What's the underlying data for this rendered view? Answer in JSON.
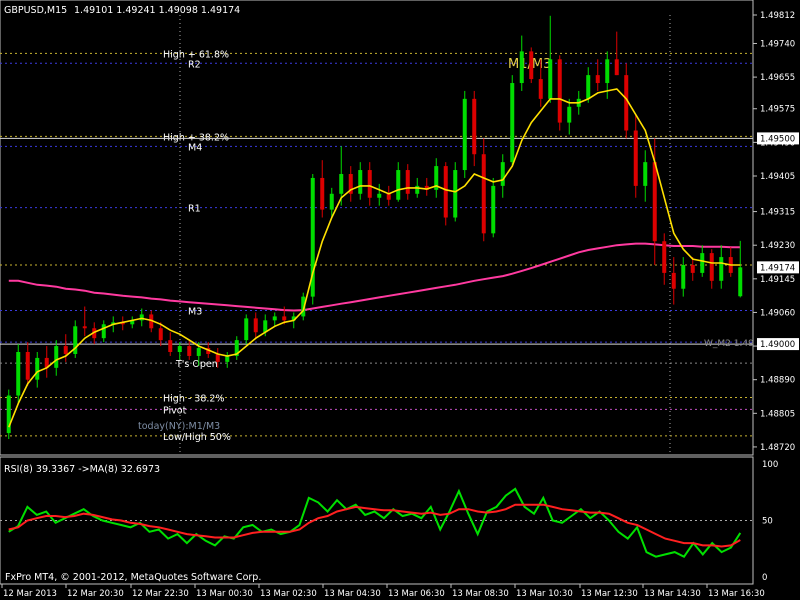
{
  "header": {
    "symbol": "GBPUSD,M15",
    "ohlc": "1.49101 1.49241 1.49098 1.49174"
  },
  "footer": {
    "copyright": "FxPro MT4, © 2001-2012, MetaQuotes Software Corp."
  },
  "colors": {
    "background": "#000000",
    "bull": "#00dd00",
    "bear": "#dd0000",
    "sma": "#ffe000",
    "ma_long": "#ff3aa0",
    "rsi": "#00e000",
    "rsi_ma": "#ff2020"
  },
  "chart_data": [
    {
      "type": "candlestick",
      "title": "GBPUSD,M15",
      "ylim": [
        1.48735,
        1.49812
      ],
      "y_ticks": [
        "1.49812",
        "1.49740",
        "1.49655",
        "1.49575",
        "1.49490",
        "1.49405",
        "1.49315",
        "1.49230",
        "1.49145",
        "1.49060",
        "1.48975",
        "1.48890",
        "1.48805",
        "1.48720"
      ],
      "current_price_label": "1.49174",
      "current_price": 1.49174,
      "line_price_label": "1.49500",
      "line_price": 1.495,
      "lower_price_label": "1.49000",
      "lower_price": 1.4898,
      "x_ticks": [
        "12 Mar 2013",
        "12 Mar 20:30",
        "12 Mar 22:30",
        "13 Mar 00:30",
        "13 Mar 02:30",
        "13 Mar 04:30",
        "13 Mar 06:30",
        "13 Mar 08:30",
        "13 Mar 10:30",
        "13 Mar 12:30",
        "13 Mar 14:30",
        "13 Mar 16:30"
      ],
      "levels": [
        {
          "label": "High + 61.8%",
          "price": 1.49715,
          "color": "#c8b430"
        },
        {
          "label": "R2",
          "price": 1.4969,
          "color": "#3a3ae0"
        },
        {
          "label": "High + 38.2%",
          "price": 1.49505,
          "color": "#c8b430"
        },
        {
          "label": "M4",
          "price": 1.4948,
          "color": "#3a3ae0"
        },
        {
          "label": "R1",
          "price": 1.49325,
          "color": "#3a3ae0"
        },
        {
          "label": "",
          "price": 1.4918,
          "color": "#c8b430"
        },
        {
          "label": "M3",
          "price": 1.49065,
          "color": "#3a3ae0"
        },
        {
          "label": "",
          "price": 1.48985,
          "color": "#3a3ae0"
        },
        {
          "label": "T's Open",
          "price": 1.48932,
          "color": "#888888"
        },
        {
          "label": "High - 38.2%",
          "price": 1.48845,
          "color": "#c8b430"
        },
        {
          "label": "Pivot",
          "price": 1.48815,
          "color": "#c050c0"
        },
        {
          "label": "Low/High 50%",
          "price": 1.48748,
          "color": "#c8b430"
        }
      ],
      "annotations": [
        "M1/M3",
        "today(NY):M1/M3",
        "W_M2 1.49"
      ],
      "candles": [
        [
          1.48755,
          1.48865,
          1.4874,
          1.4885
        ],
        [
          1.4885,
          1.4898,
          1.4883,
          1.4896
        ],
        [
          1.4896,
          1.48985,
          1.48875,
          1.4889
        ],
        [
          1.4889,
          1.4896,
          1.4887,
          1.48945
        ],
        [
          1.48945,
          1.48975,
          1.48895,
          1.4892
        ],
        [
          1.4892,
          1.4899,
          1.489,
          1.48975
        ],
        [
          1.48975,
          1.49005,
          1.48935,
          1.48955
        ],
        [
          1.48955,
          1.4904,
          1.48945,
          1.49025
        ],
        [
          1.49025,
          1.49075,
          1.49,
          1.4902
        ],
        [
          1.4902,
          1.49035,
          1.4898,
          1.48995
        ],
        [
          1.48995,
          1.4904,
          1.48985,
          1.4903
        ],
        [
          1.4903,
          1.4905,
          1.4901,
          1.49035
        ],
        [
          1.49035,
          1.4905,
          1.49015,
          1.4903
        ],
        [
          1.4903,
          1.4905,
          1.4902,
          1.4904
        ],
        [
          1.4904,
          1.4907,
          1.49025,
          1.49055
        ],
        [
          1.49055,
          1.49065,
          1.4901,
          1.4902
        ],
        [
          1.4902,
          1.49035,
          1.48975,
          1.4899
        ],
        [
          1.4899,
          1.4901,
          1.4895,
          1.4896
        ],
        [
          1.4896,
          1.48985,
          1.4894,
          1.48975
        ],
        [
          1.48975,
          1.4899,
          1.4894,
          1.4895
        ],
        [
          1.4895,
          1.48985,
          1.48925,
          1.4897
        ],
        [
          1.4897,
          1.48985,
          1.48945,
          1.48955
        ],
        [
          1.48955,
          1.4897,
          1.4892,
          1.48935
        ],
        [
          1.48935,
          1.4896,
          1.4892,
          1.4895
        ],
        [
          1.4895,
          1.49,
          1.4894,
          1.4899
        ],
        [
          1.4899,
          1.49055,
          1.4898,
          1.49045
        ],
        [
          1.49045,
          1.4906,
          1.48995,
          1.4901
        ],
        [
          1.4901,
          1.49055,
          1.49,
          1.4904
        ],
        [
          1.4904,
          1.4906,
          1.49025,
          1.4905
        ],
        [
          1.4905,
          1.49075,
          1.4903,
          1.4904
        ],
        [
          1.4904,
          1.4906,
          1.4902,
          1.4905
        ],
        [
          1.4905,
          1.4911,
          1.4904,
          1.491
        ],
        [
          1.491,
          1.4941,
          1.4908,
          1.494
        ],
        [
          1.494,
          1.49445,
          1.493,
          1.4932
        ],
        [
          1.4932,
          1.49375,
          1.493,
          1.4936
        ],
        [
          1.4936,
          1.4948,
          1.4933,
          1.4941
        ],
        [
          1.4941,
          1.4943,
          1.4934,
          1.4936
        ],
        [
          1.4936,
          1.4944,
          1.49345,
          1.4942
        ],
        [
          1.4942,
          1.4944,
          1.4933,
          1.4935
        ],
        [
          1.4935,
          1.49385,
          1.4933,
          1.4936
        ],
        [
          1.4936,
          1.4938,
          1.4933,
          1.49345
        ],
        [
          1.49345,
          1.4944,
          1.4934,
          1.4942
        ],
        [
          1.4942,
          1.49435,
          1.49345,
          1.4936
        ],
        [
          1.4936,
          1.494,
          1.4935,
          1.4938
        ],
        [
          1.4938,
          1.494,
          1.49355,
          1.4937
        ],
        [
          1.4937,
          1.4945,
          1.4935,
          1.4943
        ],
        [
          1.4943,
          1.4944,
          1.4928,
          1.493
        ],
        [
          1.493,
          1.4944,
          1.4929,
          1.4942
        ],
        [
          1.4942,
          1.4962,
          1.494,
          1.496
        ],
        [
          1.496,
          1.4962,
          1.4943,
          1.4946
        ],
        [
          1.4946,
          1.495,
          1.4924,
          1.4926
        ],
        [
          1.4926,
          1.494,
          1.4925,
          1.4938
        ],
        [
          1.4938,
          1.4946,
          1.4935,
          1.4944
        ],
        [
          1.4944,
          1.4966,
          1.4943,
          1.4964
        ],
        [
          1.4964,
          1.4976,
          1.4962,
          1.4972
        ],
        [
          1.4972,
          1.4973,
          1.4964,
          1.4965
        ],
        [
          1.4965,
          1.497,
          1.4958,
          1.496
        ],
        [
          1.496,
          1.4981,
          1.4959,
          1.497
        ],
        [
          1.497,
          1.4971,
          1.4952,
          1.4954
        ],
        [
          1.4954,
          1.496,
          1.4951,
          1.4958
        ],
        [
          1.4958,
          1.4962,
          1.4956,
          1.496
        ],
        [
          1.496,
          1.4968,
          1.4959,
          1.4966
        ],
        [
          1.4966,
          1.497,
          1.4962,
          1.4964
        ],
        [
          1.4964,
          1.4972,
          1.496,
          1.497
        ],
        [
          1.497,
          1.4977,
          1.4966,
          1.4966
        ],
        [
          1.4966,
          1.4969,
          1.495,
          1.4952
        ],
        [
          1.4952,
          1.4956,
          1.4935,
          1.4938
        ],
        [
          1.4938,
          1.4947,
          1.4934,
          1.4944
        ],
        [
          1.4944,
          1.495,
          1.4918,
          1.4924
        ],
        [
          1.4924,
          1.4926,
          1.4913,
          1.4916
        ],
        [
          1.4916,
          1.492,
          1.4908,
          1.4912
        ],
        [
          1.4912,
          1.492,
          1.491,
          1.4918
        ],
        [
          1.4918,
          1.492,
          1.4914,
          1.4916
        ],
        [
          1.4916,
          1.4923,
          1.4915,
          1.4921
        ],
        [
          1.4921,
          1.4922,
          1.4912,
          1.4914
        ],
        [
          1.4914,
          1.4923,
          1.4912,
          1.492
        ],
        [
          1.492,
          1.49225,
          1.4915,
          1.4916
        ],
        [
          1.49101,
          1.49241,
          1.49098,
          1.49174
        ]
      ],
      "sma": [
        1.4877,
        1.4883,
        1.4888,
        1.4891,
        1.4892,
        1.4894,
        1.4895,
        1.4897,
        1.48995,
        1.4901,
        1.4902,
        1.4903,
        1.49035,
        1.4904,
        1.49045,
        1.4904,
        1.4903,
        1.49015,
        1.49005,
        1.4899,
        1.48975,
        1.48965,
        1.48955,
        1.4895,
        1.48955,
        1.48975,
        1.48995,
        1.4901,
        1.49025,
        1.49035,
        1.4904,
        1.49065,
        1.4916,
        1.4924,
        1.493,
        1.4935,
        1.4937,
        1.4938,
        1.4938,
        1.4937,
        1.4936,
        1.4937,
        1.49375,
        1.49375,
        1.49372,
        1.4938,
        1.4937,
        1.49365,
        1.4938,
        1.4941,
        1.494,
        1.4939,
        1.49395,
        1.4943,
        1.49495,
        1.4954,
        1.4957,
        1.496,
        1.496,
        1.4959,
        1.4959,
        1.496,
        1.49615,
        1.4962,
        1.49625,
        1.496,
        1.4956,
        1.4952,
        1.4944,
        1.4935,
        1.4926,
        1.4922,
        1.49195,
        1.4919,
        1.49185,
        1.49185,
        1.4918,
        1.4918
      ],
      "ma_long": [
        1.4914,
        1.4914,
        1.49135,
        1.4913,
        1.49128,
        1.49125,
        1.4912,
        1.49118,
        1.49115,
        1.4911,
        1.49108,
        1.49105,
        1.49102,
        1.491,
        1.49098,
        1.49095,
        1.49093,
        1.4909,
        1.49088,
        1.49086,
        1.49084,
        1.49082,
        1.4908,
        1.49078,
        1.49076,
        1.49074,
        1.49072,
        1.4907,
        1.49068,
        1.49066,
        1.49065,
        1.49066,
        1.4907,
        1.49074,
        1.49078,
        1.49082,
        1.49086,
        1.4909,
        1.49094,
        1.49098,
        1.49102,
        1.49106,
        1.4911,
        1.49114,
        1.49118,
        1.49122,
        1.49126,
        1.4913,
        1.49135,
        1.4914,
        1.49144,
        1.49148,
        1.49152,
        1.49158,
        1.49165,
        1.49172,
        1.4918,
        1.49188,
        1.49196,
        1.49204,
        1.49212,
        1.49218,
        1.49222,
        1.49226,
        1.4923,
        1.49232,
        1.49234,
        1.49234,
        1.49232,
        1.4923,
        1.49228,
        1.49228,
        1.49228,
        1.49226,
        1.49226,
        1.49226,
        1.49225,
        1.49225
      ]
    },
    {
      "type": "line",
      "title": "RSI(8) 39.3367  ->MA(8) 32.6973",
      "ylim": [
        0,
        100
      ],
      "y_ticks": [
        "100",
        "50",
        "0"
      ],
      "series": [
        {
          "name": "RSI(8)",
          "color": "#00e000",
          "values": [
            40,
            45,
            62,
            55,
            58,
            48,
            52,
            56,
            60,
            54,
            50,
            48,
            46,
            44,
            48,
            40,
            42,
            34,
            38,
            30,
            38,
            32,
            28,
            36,
            34,
            44,
            46,
            40,
            42,
            38,
            40,
            46,
            70,
            66,
            58,
            68,
            60,
            64,
            55,
            58,
            52,
            60,
            54,
            56,
            52,
            62,
            42,
            58,
            76,
            56,
            38,
            58,
            62,
            72,
            78,
            62,
            56,
            70,
            50,
            48,
            54,
            60,
            52,
            58,
            50,
            40,
            34,
            44,
            22,
            18,
            20,
            22,
            18,
            30,
            20,
            30,
            22,
            26,
            39
          ]
        },
        {
          "name": "MA(8)",
          "color": "#ff2020",
          "values": [
            42,
            44,
            50,
            52,
            54,
            54,
            53,
            54,
            56,
            55,
            53,
            51,
            50,
            48,
            47,
            45,
            44,
            42,
            40,
            38,
            37,
            36,
            35,
            35,
            35,
            37,
            39,
            40,
            40,
            40,
            40,
            42,
            48,
            52,
            54,
            58,
            60,
            62,
            61,
            60,
            59,
            59,
            58,
            57,
            56,
            57,
            55,
            56,
            60,
            60,
            58,
            57,
            58,
            60,
            64,
            64,
            64,
            64,
            62,
            60,
            59,
            58,
            57,
            57,
            56,
            52,
            48,
            46,
            42,
            38,
            34,
            32,
            30,
            30,
            28,
            28,
            27,
            28,
            32.7
          ]
        }
      ]
    }
  ]
}
